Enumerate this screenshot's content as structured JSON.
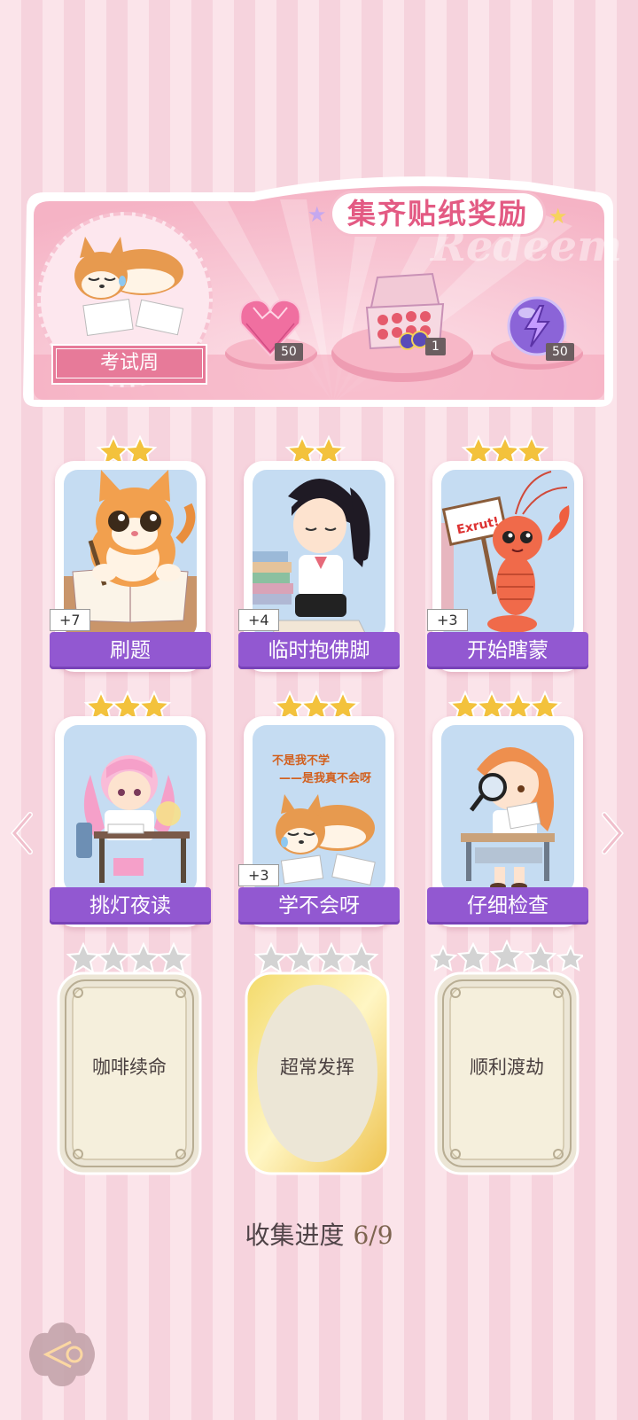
{
  "banner": {
    "title": "集齐贴纸奖励",
    "watermark": "Redeem",
    "event_name": "考试周",
    "rewards": [
      {
        "icon": "pink-heart-gem-icon",
        "count": "50"
      },
      {
        "icon": "sticker-box-icon",
        "count": "1"
      },
      {
        "icon": "purple-energy-orb-icon",
        "count": "50"
      }
    ]
  },
  "cards": [
    {
      "label": "刷题",
      "stars": 2,
      "bonus": "+7",
      "icon": "cat-writing-icon"
    },
    {
      "label": "临时抱佛脚",
      "stars": 2,
      "bonus": "+4",
      "icon": "girl-reading-icon"
    },
    {
      "label": "开始瞎蒙",
      "stars": 3,
      "bonus": "+3",
      "icon": "shrimp-sign-icon",
      "sign_text": "Exrut!"
    },
    {
      "label": "挑灯夜读",
      "stars": 3,
      "bonus": "",
      "icon": "pink-girl-desk-icon"
    },
    {
      "label": "学不会呀",
      "stars": 3,
      "bonus": "+3",
      "icon": "shiba-crying-icon",
      "caption_line1": "不是我不学",
      "caption_line2": "——是我真不会呀"
    },
    {
      "label": "仔细检查",
      "stars": 4,
      "bonus": "",
      "icon": "girl-magnifier-icon"
    }
  ],
  "locked_cards": [
    {
      "label": "咖啡续命",
      "stars": 4,
      "style": "silver"
    },
    {
      "label": "超常发挥",
      "stars": 4,
      "style": "gold"
    },
    {
      "label": "顺利渡劫",
      "stars": 5,
      "style": "silver"
    }
  ],
  "progress": {
    "label": "收集进度",
    "value": "6/9"
  },
  "nav": {
    "prev": "chevron-left-icon",
    "next": "chevron-right-icon",
    "back": "back-button-icon"
  },
  "colors": {
    "label_purple": "#9258d1",
    "banner_pink": "#f4a7bd",
    "star_gold": "#f3c23c"
  }
}
